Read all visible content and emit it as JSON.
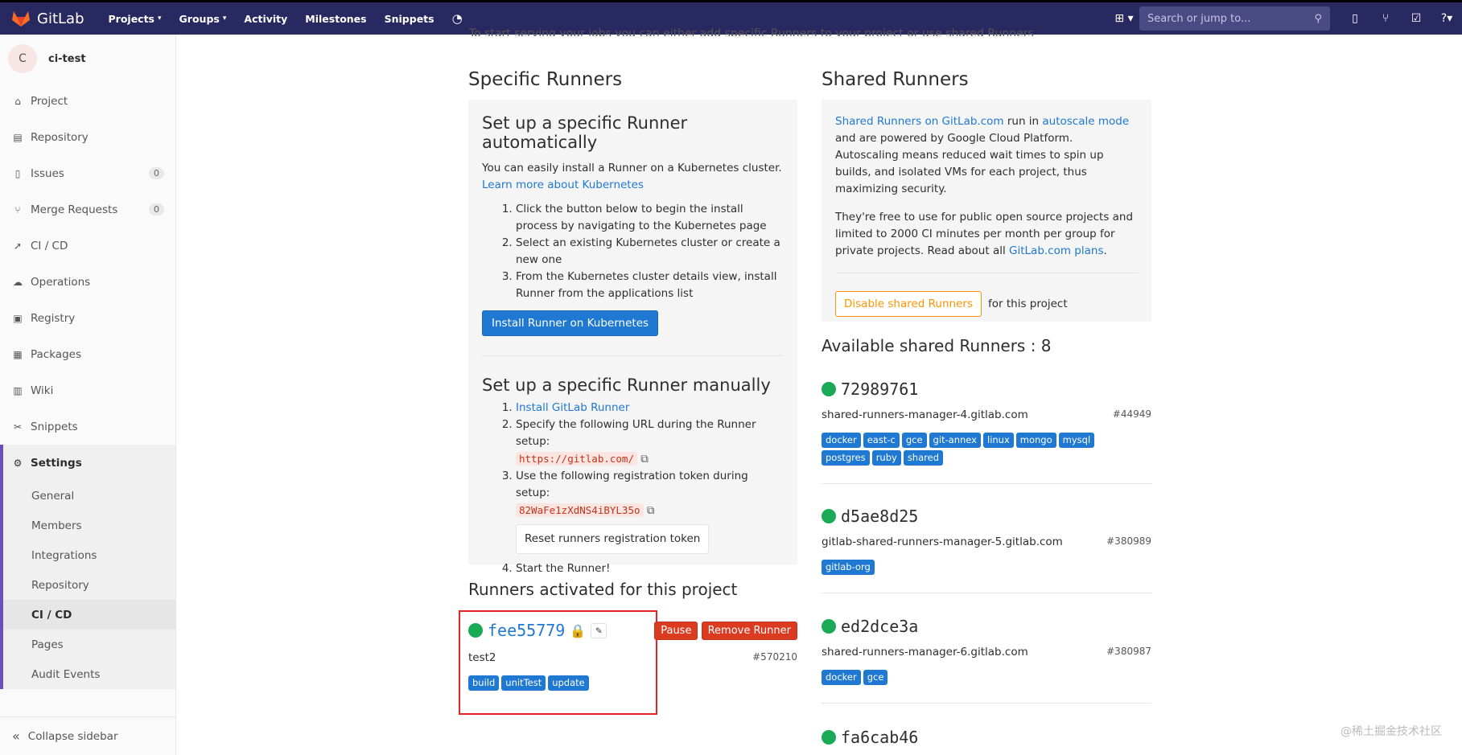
{
  "nav": {
    "brand": "GitLab",
    "links": [
      "Projects",
      "Groups",
      "Activity",
      "Milestones",
      "Snippets"
    ],
    "search_placeholder": "Search or jump to..."
  },
  "sidebar": {
    "avatar_letter": "C",
    "project_name": "ci-test",
    "items": [
      {
        "label": "Project",
        "icon": "home-icon"
      },
      {
        "label": "Repository",
        "icon": "doc-icon"
      },
      {
        "label": "Issues",
        "icon": "issues-icon",
        "badge": "0"
      },
      {
        "label": "Merge Requests",
        "icon": "merge-icon",
        "badge": "0"
      },
      {
        "label": "CI / CD",
        "icon": "rocket-icon"
      },
      {
        "label": "Operations",
        "icon": "cloud-icon"
      },
      {
        "label": "Registry",
        "icon": "box-icon"
      },
      {
        "label": "Packages",
        "icon": "package-icon"
      },
      {
        "label": "Wiki",
        "icon": "book-icon"
      },
      {
        "label": "Snippets",
        "icon": "scissors-icon"
      }
    ],
    "settings_label": "Settings",
    "sub_items": [
      "General",
      "Members",
      "Integrations",
      "Repository",
      "CI / CD",
      "Pages",
      "Audit Events"
    ],
    "collapse_label": "Collapse sidebar"
  },
  "top_line": "To start serving your jobs you can either add specific Runners to your project or use shared Runners",
  "specific": {
    "heading": "Specific Runners",
    "auto_title": "Set up a specific Runner automatically",
    "auto_text": "You can easily install a Runner on a Kubernetes cluster.",
    "auto_link": "Learn more about Kubernetes",
    "auto_steps": [
      "Click the button below to begin the install process by navigating to the Kubernetes page",
      "Select an existing Kubernetes cluster or create a new one",
      "From the Kubernetes cluster details view, install Runner from the applications list"
    ],
    "install_button": "Install Runner on Kubernetes",
    "manual_title": "Set up a specific Runner manually",
    "manual_step1_link": "Install GitLab Runner",
    "manual_step2": "Specify the following URL during the Runner setup:",
    "url": "https://gitlab.com/",
    "manual_step3": "Use the following registration token during setup:",
    "token": "82WaFe1zXdNS4iBYL35o",
    "reset_button": "Reset runners registration token",
    "manual_step4": "Start the Runner!"
  },
  "activated": {
    "heading": "Runners activated for this project",
    "runner_id": "fee55779",
    "pause_button": "Pause",
    "remove_button": "Remove Runner",
    "description": "test2",
    "number": "#570210",
    "tags": [
      "build",
      "unitTest",
      "update"
    ]
  },
  "shared": {
    "heading": "Shared Runners",
    "info_link1": "Shared Runners on GitLab.com",
    "info_mid": " run in ",
    "info_link2": "autoscale mode",
    "info_rest": " and are powered by Google Cloud Platform. Autoscaling means reduced wait times to spin up builds, and isolated VMs for each project, thus maximizing security.",
    "free_text": "They're free to use for public open source projects and limited to 2000 CI minutes per month per group for private projects. Read about all ",
    "plans_link": "GitLab.com plans",
    "plans_end": ".",
    "disable_button": "Disable shared Runners",
    "for_project": "for this project",
    "available": "Available shared Runners : 8",
    "runners": [
      {
        "id": "72989761",
        "host": "shared-runners-manager-4.gitlab.com",
        "number": "#44949",
        "tags": [
          "docker",
          "east-c",
          "gce",
          "git-annex",
          "linux",
          "mongo",
          "mysql",
          "postgres",
          "ruby",
          "shared"
        ]
      },
      {
        "id": "d5ae8d25",
        "host": "gitlab-shared-runners-manager-5.gitlab.com",
        "number": "#380989",
        "tags": [
          "gitlab-org"
        ]
      },
      {
        "id": "ed2dce3a",
        "host": "shared-runners-manager-6.gitlab.com",
        "number": "#380987",
        "tags": [
          "docker",
          "gce"
        ]
      },
      {
        "id": "fa6cab46",
        "host": "",
        "number": "",
        "tags": []
      }
    ]
  },
  "watermark": "@稀土掘金技术社区"
}
